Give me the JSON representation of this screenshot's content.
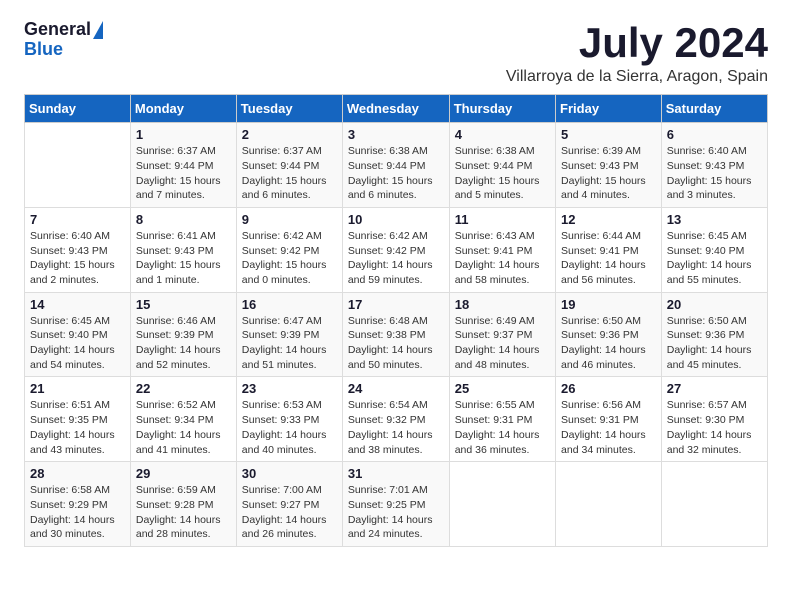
{
  "logo": {
    "general": "General",
    "blue": "Blue"
  },
  "title": {
    "month": "July 2024",
    "location": "Villarroya de la Sierra, Aragon, Spain"
  },
  "days_of_week": [
    "Sunday",
    "Monday",
    "Tuesday",
    "Wednesday",
    "Thursday",
    "Friday",
    "Saturday"
  ],
  "weeks": [
    [
      {
        "day": "",
        "info": ""
      },
      {
        "day": "1",
        "info": "Sunrise: 6:37 AM\nSunset: 9:44 PM\nDaylight: 15 hours\nand 7 minutes."
      },
      {
        "day": "2",
        "info": "Sunrise: 6:37 AM\nSunset: 9:44 PM\nDaylight: 15 hours\nand 6 minutes."
      },
      {
        "day": "3",
        "info": "Sunrise: 6:38 AM\nSunset: 9:44 PM\nDaylight: 15 hours\nand 6 minutes."
      },
      {
        "day": "4",
        "info": "Sunrise: 6:38 AM\nSunset: 9:44 PM\nDaylight: 15 hours\nand 5 minutes."
      },
      {
        "day": "5",
        "info": "Sunrise: 6:39 AM\nSunset: 9:43 PM\nDaylight: 15 hours\nand 4 minutes."
      },
      {
        "day": "6",
        "info": "Sunrise: 6:40 AM\nSunset: 9:43 PM\nDaylight: 15 hours\nand 3 minutes."
      }
    ],
    [
      {
        "day": "7",
        "info": "Sunrise: 6:40 AM\nSunset: 9:43 PM\nDaylight: 15 hours\nand 2 minutes."
      },
      {
        "day": "8",
        "info": "Sunrise: 6:41 AM\nSunset: 9:43 PM\nDaylight: 15 hours\nand 1 minute."
      },
      {
        "day": "9",
        "info": "Sunrise: 6:42 AM\nSunset: 9:42 PM\nDaylight: 15 hours\nand 0 minutes."
      },
      {
        "day": "10",
        "info": "Sunrise: 6:42 AM\nSunset: 9:42 PM\nDaylight: 14 hours\nand 59 minutes."
      },
      {
        "day": "11",
        "info": "Sunrise: 6:43 AM\nSunset: 9:41 PM\nDaylight: 14 hours\nand 58 minutes."
      },
      {
        "day": "12",
        "info": "Sunrise: 6:44 AM\nSunset: 9:41 PM\nDaylight: 14 hours\nand 56 minutes."
      },
      {
        "day": "13",
        "info": "Sunrise: 6:45 AM\nSunset: 9:40 PM\nDaylight: 14 hours\nand 55 minutes."
      }
    ],
    [
      {
        "day": "14",
        "info": "Sunrise: 6:45 AM\nSunset: 9:40 PM\nDaylight: 14 hours\nand 54 minutes."
      },
      {
        "day": "15",
        "info": "Sunrise: 6:46 AM\nSunset: 9:39 PM\nDaylight: 14 hours\nand 52 minutes."
      },
      {
        "day": "16",
        "info": "Sunrise: 6:47 AM\nSunset: 9:39 PM\nDaylight: 14 hours\nand 51 minutes."
      },
      {
        "day": "17",
        "info": "Sunrise: 6:48 AM\nSunset: 9:38 PM\nDaylight: 14 hours\nand 50 minutes."
      },
      {
        "day": "18",
        "info": "Sunrise: 6:49 AM\nSunset: 9:37 PM\nDaylight: 14 hours\nand 48 minutes."
      },
      {
        "day": "19",
        "info": "Sunrise: 6:50 AM\nSunset: 9:36 PM\nDaylight: 14 hours\nand 46 minutes."
      },
      {
        "day": "20",
        "info": "Sunrise: 6:50 AM\nSunset: 9:36 PM\nDaylight: 14 hours\nand 45 minutes."
      }
    ],
    [
      {
        "day": "21",
        "info": "Sunrise: 6:51 AM\nSunset: 9:35 PM\nDaylight: 14 hours\nand 43 minutes."
      },
      {
        "day": "22",
        "info": "Sunrise: 6:52 AM\nSunset: 9:34 PM\nDaylight: 14 hours\nand 41 minutes."
      },
      {
        "day": "23",
        "info": "Sunrise: 6:53 AM\nSunset: 9:33 PM\nDaylight: 14 hours\nand 40 minutes."
      },
      {
        "day": "24",
        "info": "Sunrise: 6:54 AM\nSunset: 9:32 PM\nDaylight: 14 hours\nand 38 minutes."
      },
      {
        "day": "25",
        "info": "Sunrise: 6:55 AM\nSunset: 9:31 PM\nDaylight: 14 hours\nand 36 minutes."
      },
      {
        "day": "26",
        "info": "Sunrise: 6:56 AM\nSunset: 9:31 PM\nDaylight: 14 hours\nand 34 minutes."
      },
      {
        "day": "27",
        "info": "Sunrise: 6:57 AM\nSunset: 9:30 PM\nDaylight: 14 hours\nand 32 minutes."
      }
    ],
    [
      {
        "day": "28",
        "info": "Sunrise: 6:58 AM\nSunset: 9:29 PM\nDaylight: 14 hours\nand 30 minutes."
      },
      {
        "day": "29",
        "info": "Sunrise: 6:59 AM\nSunset: 9:28 PM\nDaylight: 14 hours\nand 28 minutes."
      },
      {
        "day": "30",
        "info": "Sunrise: 7:00 AM\nSunset: 9:27 PM\nDaylight: 14 hours\nand 26 minutes."
      },
      {
        "day": "31",
        "info": "Sunrise: 7:01 AM\nSunset: 9:25 PM\nDaylight: 14 hours\nand 24 minutes."
      },
      {
        "day": "",
        "info": ""
      },
      {
        "day": "",
        "info": ""
      },
      {
        "day": "",
        "info": ""
      }
    ]
  ]
}
